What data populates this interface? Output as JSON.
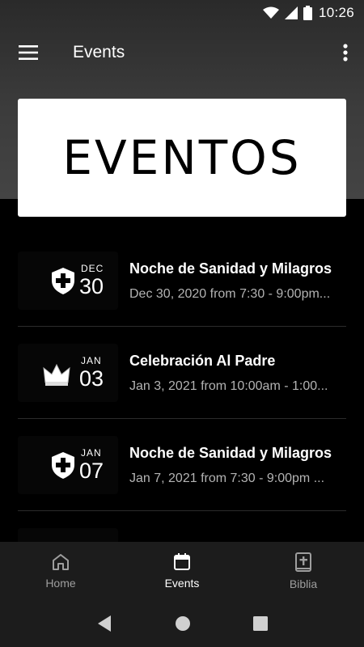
{
  "status_bar": {
    "time": "10:26"
  },
  "app_bar": {
    "title": "Events"
  },
  "banner": {
    "text": "EVENTOS"
  },
  "events": [
    {
      "month": "DEC",
      "day": "30",
      "icon": "shield-cross-icon",
      "title": "Noche de Sanidad y Milagros",
      "subtitle": "Dec 30, 2020 from 7:30 - 9:00pm..."
    },
    {
      "month": "JAN",
      "day": "03",
      "icon": "crown-icon",
      "title": "Celebración Al Padre",
      "subtitle": "Jan 3, 2021 from 10:00am - 1:00..."
    },
    {
      "month": "JAN",
      "day": "07",
      "icon": "shield-cross-icon",
      "title": "Noche de Sanidad y Milagros",
      "subtitle": "Jan 7, 2021 from 7:30 - 9:00pm ..."
    }
  ],
  "bottom_nav": {
    "items": [
      {
        "label": "Home",
        "icon": "home-icon"
      },
      {
        "label": "Events",
        "icon": "calendar-icon",
        "active": true
      },
      {
        "label": "Biblia",
        "icon": "bible-icon"
      }
    ]
  }
}
